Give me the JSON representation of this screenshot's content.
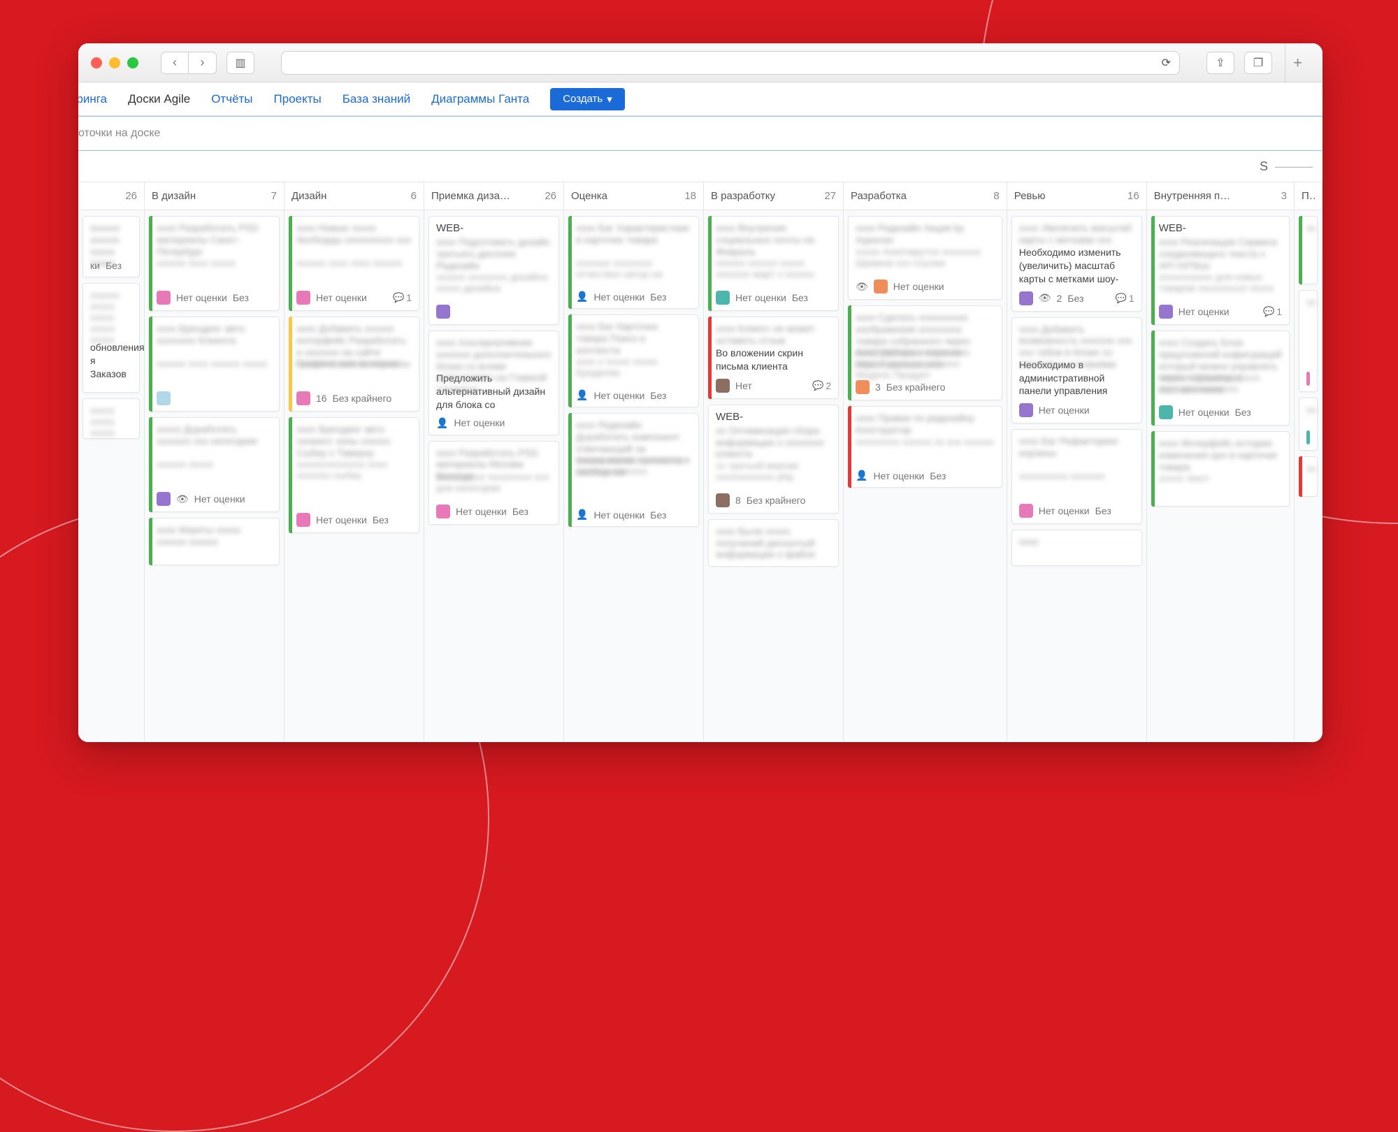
{
  "nav": {
    "cut_first": "оринга",
    "items": [
      "Доски Agile",
      "Отчёты",
      "Проекты",
      "База знаний",
      "Диаграммы Ганта"
    ],
    "active_index": 0,
    "create": "Создать"
  },
  "search": {
    "placeholder": "оточки на доске"
  },
  "filter_right": "S",
  "columns": [
    {
      "title": "",
      "count": "26",
      "first": true
    },
    {
      "title": "В дизайн",
      "count": "7"
    },
    {
      "title": "Дизайн",
      "count": "6"
    },
    {
      "title": "Приемка диза…",
      "count": "26"
    },
    {
      "title": "Оценка",
      "count": "18"
    },
    {
      "title": "В разработку",
      "count": "27"
    },
    {
      "title": "Разработка",
      "count": "8"
    },
    {
      "title": "Ревью",
      "count": "16"
    },
    {
      "title": "Внутренняя п…",
      "count": "3"
    },
    {
      "title": "Пр",
      "count": ""
    }
  ],
  "labels": {
    "no_estimate": "Нет оценки",
    "bez": "Без",
    "no": "Нет",
    "bez_krainego": "Без крайнего",
    "web_tag": "WEB-",
    "clear_texts": {
      "alt_design": "Предложить альтернативный дизайн для блока со",
      "attach_screen": "Во вложении скрин письма клиента",
      "map_scale": "Необходимо изменить (увеличить) масштаб карты с метками шоу-",
      "admin_panel": "Необходимо в административной панели управления",
      "update_orders": "обновления я Заказов"
    },
    "nums": {
      "n2": "2",
      "n3": "3",
      "n8": "8",
      "n16": "16",
      "comment1": "1",
      "comment2": "2"
    }
  }
}
